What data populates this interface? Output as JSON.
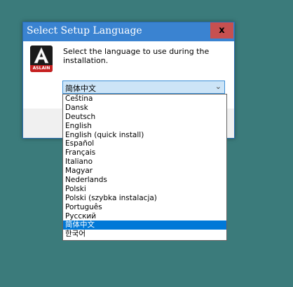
{
  "window": {
    "title": "Select Setup Language",
    "close_label": "x"
  },
  "logo": {
    "mark": "A",
    "band_text": "ASLAIN"
  },
  "prompt": "Select the language to use during the installation.",
  "language_select": {
    "selected": "简体中文",
    "arrow": "⌄",
    "options": [
      "Čeština",
      "Dansk",
      "Deutsch",
      "English",
      "English (quick install)",
      "Español",
      "Français",
      "Italiano",
      "Magyar",
      "Nederlands",
      "Polski",
      "Polski (szybka instalacja)",
      "Português",
      "Русский",
      "简体中文",
      "한국어"
    ]
  },
  "colors": {
    "desktop": "#3b7b7b",
    "titlebar": "#3a83d1",
    "close_button": "#c75050",
    "selection": "#0078d7"
  }
}
